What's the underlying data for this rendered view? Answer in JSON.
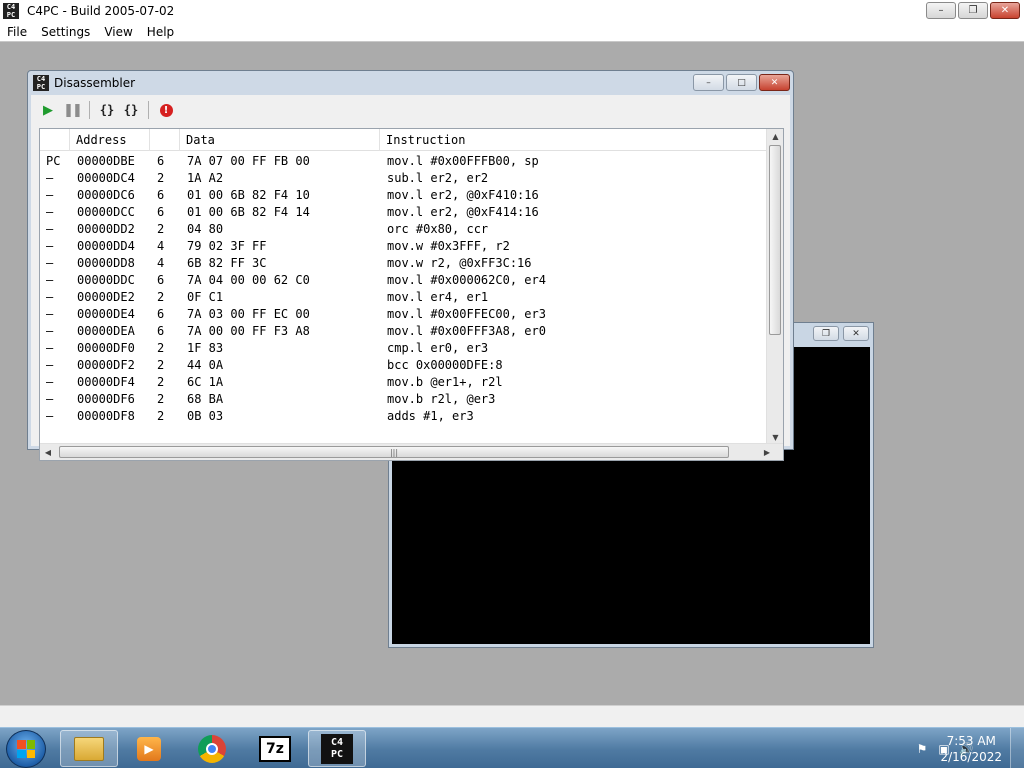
{
  "app": {
    "title": "C4PC - Build 2005-07-02",
    "icon_text": "C4 PC",
    "caption": {
      "minimize": "–",
      "restore": "❐",
      "close": "✕"
    }
  },
  "menu": [
    "File",
    "Settings",
    "View",
    "Help"
  ],
  "disassembler": {
    "title": "Disassembler",
    "toolbar": [
      "run-icon",
      "pause-icon",
      "step-into-icon",
      "step-over-icon",
      "stop-icon"
    ],
    "columns": {
      "mark": "",
      "address": "Address",
      "len": "",
      "data": "Data",
      "instruction": "Instruction"
    },
    "rows": [
      {
        "mark": "PC",
        "address": "00000DBE",
        "len": "6",
        "data": "7A 07 00 FF FB 00",
        "instruction": "mov.l #0x00FFFB00, sp"
      },
      {
        "mark": "–",
        "address": "00000DC4",
        "len": "2",
        "data": "1A A2",
        "instruction": "sub.l er2, er2"
      },
      {
        "mark": "–",
        "address": "00000DC6",
        "len": "6",
        "data": "01 00 6B 82 F4 10",
        "instruction": "mov.l er2, @0xF410:16"
      },
      {
        "mark": "–",
        "address": "00000DCC",
        "len": "6",
        "data": "01 00 6B 82 F4 14",
        "instruction": "mov.l er2, @0xF414:16"
      },
      {
        "mark": "–",
        "address": "00000DD2",
        "len": "2",
        "data": "04 80",
        "instruction": "orc #0x80, ccr"
      },
      {
        "mark": "–",
        "address": "00000DD4",
        "len": "4",
        "data": "79 02 3F FF",
        "instruction": "mov.w #0x3FFF, r2"
      },
      {
        "mark": "–",
        "address": "00000DD8",
        "len": "4",
        "data": "6B 82 FF 3C",
        "instruction": "mov.w r2, @0xFF3C:16"
      },
      {
        "mark": "–",
        "address": "00000DDC",
        "len": "6",
        "data": "7A 04 00 00 62 C0",
        "instruction": "mov.l #0x000062C0, er4"
      },
      {
        "mark": "–",
        "address": "00000DE2",
        "len": "2",
        "data": "0F C1",
        "instruction": "mov.l er4, er1"
      },
      {
        "mark": "–",
        "address": "00000DE4",
        "len": "6",
        "data": "7A 03 00 FF EC 00",
        "instruction": "mov.l #0x00FFEC00, er3"
      },
      {
        "mark": "–",
        "address": "00000DEA",
        "len": "6",
        "data": "7A 00 00 FF F3 A8",
        "instruction": "mov.l #0x00FFF3A8, er0"
      },
      {
        "mark": "–",
        "address": "00000DF0",
        "len": "2",
        "data": "1F 83",
        "instruction": "cmp.l er0, er3"
      },
      {
        "mark": "–",
        "address": "00000DF2",
        "len": "2",
        "data": "44 0A",
        "instruction": "bcc 0x00000DFE:8"
      },
      {
        "mark": "–",
        "address": "00000DF4",
        "len": "2",
        "data": "6C 1A",
        "instruction": "mov.b @er1+, r2l"
      },
      {
        "mark": "–",
        "address": "00000DF6",
        "len": "2",
        "data": "68 BA",
        "instruction": "mov.b r2l, @er3"
      },
      {
        "mark": "–",
        "address": "00000DF8",
        "len": "2",
        "data": "0B 03",
        "instruction": "adds #1, er3"
      }
    ]
  },
  "taskbar": {
    "apps": [
      "explorer-icon",
      "media-player-icon",
      "chrome-icon",
      "7zip-icon",
      "c4pc-icon"
    ],
    "z7_text": "7z",
    "c4pc_text": [
      "C4",
      "PC"
    ],
    "clock_time": "7:53 AM",
    "clock_date": "2/16/2022"
  }
}
